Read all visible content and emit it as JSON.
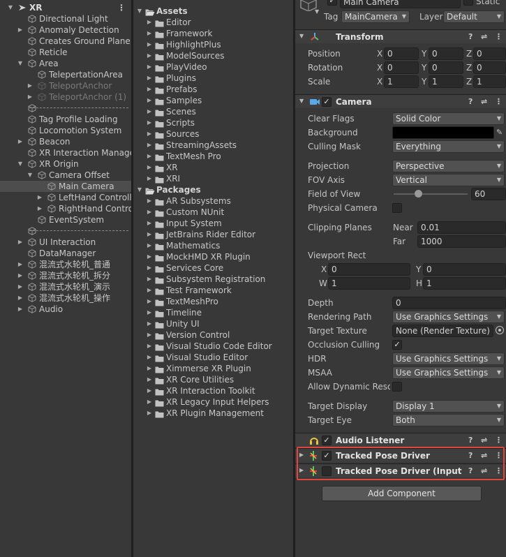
{
  "hierarchy": {
    "menu_glyph": "⋮",
    "rows": [
      {
        "label": "XR",
        "depth": 0,
        "arrow": "down",
        "icon": "unity-scene-icon",
        "scene": true
      },
      {
        "label": "Directional Light",
        "depth": 1,
        "arrow": "none"
      },
      {
        "label": "Anomaly Detection",
        "depth": 1,
        "arrow": "right"
      },
      {
        "label": "Creates Ground Plane",
        "depth": 1,
        "arrow": "none"
      },
      {
        "label": "Reticle",
        "depth": 1,
        "arrow": "none"
      },
      {
        "label": "Area",
        "depth": 1,
        "arrow": "down"
      },
      {
        "label": "TelepertationArea",
        "depth": 2,
        "arrow": "none"
      },
      {
        "label": "TeleportAnchor",
        "depth": 2,
        "arrow": "right",
        "dim": true
      },
      {
        "label": "TeleportAnchor (1)",
        "depth": 2,
        "arrow": "right",
        "dim": true
      },
      {
        "label": "",
        "depth": 1,
        "arrow": "none",
        "separator": true
      },
      {
        "label": "Tag Profile Loading",
        "depth": 1,
        "arrow": "none"
      },
      {
        "label": "Locomotion System",
        "depth": 1,
        "arrow": "none"
      },
      {
        "label": "Beacon",
        "depth": 1,
        "arrow": "right"
      },
      {
        "label": "XR Interaction Manager",
        "depth": 1,
        "arrow": "none"
      },
      {
        "label": "XR Origin",
        "depth": 1,
        "arrow": "down"
      },
      {
        "label": "Camera Offset",
        "depth": 2,
        "arrow": "down"
      },
      {
        "label": "Main Camera",
        "depth": 3,
        "arrow": "none",
        "selected": true
      },
      {
        "label": "LeftHand Controller",
        "depth": 3,
        "arrow": "right"
      },
      {
        "label": "RightHand Controller",
        "depth": 3,
        "arrow": "right"
      },
      {
        "label": "EventSystem",
        "depth": 2,
        "arrow": "none"
      },
      {
        "label": "",
        "depth": 1,
        "arrow": "none",
        "separator": true
      },
      {
        "label": "UI Interaction",
        "depth": 1,
        "arrow": "right"
      },
      {
        "label": "DataManager",
        "depth": 1,
        "arrow": "none"
      },
      {
        "label": "混流式水轮机_普通",
        "depth": 1,
        "arrow": "right"
      },
      {
        "label": "混流式水轮机_拆分",
        "depth": 1,
        "arrow": "right"
      },
      {
        "label": "混流式水轮机_演示",
        "depth": 1,
        "arrow": "right"
      },
      {
        "label": "混流式水轮机_操作",
        "depth": 1,
        "arrow": "right"
      },
      {
        "label": "Audio",
        "depth": 1,
        "arrow": "right"
      }
    ]
  },
  "project": {
    "rows": [
      {
        "label": "Assets",
        "depth": 0,
        "arrow": "down",
        "root": true
      },
      {
        "label": "Editor",
        "depth": 1,
        "arrow": "right"
      },
      {
        "label": "Framework",
        "depth": 1,
        "arrow": "right"
      },
      {
        "label": "HighlightPlus",
        "depth": 1,
        "arrow": "right"
      },
      {
        "label": "ModelSources",
        "depth": 1,
        "arrow": "right"
      },
      {
        "label": "PlayVideo",
        "depth": 1,
        "arrow": "right"
      },
      {
        "label": "Plugins",
        "depth": 1,
        "arrow": "right"
      },
      {
        "label": "Prefabs",
        "depth": 1,
        "arrow": "right"
      },
      {
        "label": "Samples",
        "depth": 1,
        "arrow": "right"
      },
      {
        "label": "Scenes",
        "depth": 1,
        "arrow": "right"
      },
      {
        "label": "Scripts",
        "depth": 1,
        "arrow": "right"
      },
      {
        "label": "Sources",
        "depth": 1,
        "arrow": "right"
      },
      {
        "label": "StreamingAssets",
        "depth": 1,
        "arrow": "right"
      },
      {
        "label": "TextMesh Pro",
        "depth": 1,
        "arrow": "right"
      },
      {
        "label": "XR",
        "depth": 1,
        "arrow": "right"
      },
      {
        "label": "XRI",
        "depth": 1,
        "arrow": "right"
      },
      {
        "label": "Packages",
        "depth": 0,
        "arrow": "down",
        "root": true
      },
      {
        "label": "AR Subsystems",
        "depth": 1,
        "arrow": "right"
      },
      {
        "label": "Custom NUnit",
        "depth": 1,
        "arrow": "right"
      },
      {
        "label": "Input System",
        "depth": 1,
        "arrow": "right"
      },
      {
        "label": "JetBrains Rider Editor",
        "depth": 1,
        "arrow": "right"
      },
      {
        "label": "Mathematics",
        "depth": 1,
        "arrow": "right"
      },
      {
        "label": "MockHMD XR Plugin",
        "depth": 1,
        "arrow": "right"
      },
      {
        "label": "Services Core",
        "depth": 1,
        "arrow": "right"
      },
      {
        "label": "Subsystem Registration",
        "depth": 1,
        "arrow": "right"
      },
      {
        "label": "Test Framework",
        "depth": 1,
        "arrow": "right"
      },
      {
        "label": "TextMeshPro",
        "depth": 1,
        "arrow": "right"
      },
      {
        "label": "Timeline",
        "depth": 1,
        "arrow": "right"
      },
      {
        "label": "Unity UI",
        "depth": 1,
        "arrow": "right"
      },
      {
        "label": "Version Control",
        "depth": 1,
        "arrow": "right"
      },
      {
        "label": "Visual Studio Code Editor",
        "depth": 1,
        "arrow": "right"
      },
      {
        "label": "Visual Studio Editor",
        "depth": 1,
        "arrow": "right"
      },
      {
        "label": "Ximmerse XR Plugin",
        "depth": 1,
        "arrow": "right"
      },
      {
        "label": "XR Core Utilities",
        "depth": 1,
        "arrow": "right"
      },
      {
        "label": "XR Interaction Toolkit",
        "depth": 1,
        "arrow": "right"
      },
      {
        "label": "XR Legacy Input Helpers",
        "depth": 1,
        "arrow": "right"
      },
      {
        "label": "XR Plugin Management",
        "depth": 1,
        "arrow": "right"
      }
    ]
  },
  "inspector": {
    "object_name": "Main Camera",
    "static_label": "Static",
    "tag_label": "Tag",
    "tag_value": "MainCamera",
    "layer_label": "Layer",
    "layer_value": "Default",
    "transform": {
      "title": "Transform",
      "axis_x": "X",
      "axis_y": "Y",
      "axis_z": "Z",
      "position_label": "Position",
      "position": {
        "x": "0",
        "y": "0",
        "z": "0"
      },
      "rotation_label": "Rotation",
      "rotation": {
        "x": "0",
        "y": "0",
        "z": "0"
      },
      "scale_label": "Scale",
      "scale": {
        "x": "1",
        "y": "1",
        "z": "1"
      }
    },
    "camera": {
      "title": "Camera",
      "clear_flags_label": "Clear Flags",
      "clear_flags": "Solid Color",
      "background_label": "Background",
      "background_color": "#000000",
      "culling_mask_label": "Culling Mask",
      "culling_mask": "Everything",
      "projection_label": "Projection",
      "projection": "Perspective",
      "fov_axis_label": "FOV Axis",
      "fov_axis": "Vertical",
      "fov_label": "Field of View",
      "fov_value": "60",
      "fov_slider_fraction": 0.33,
      "physical_camera_label": "Physical Camera",
      "clipping_planes_label": "Clipping Planes",
      "near_label": "Near",
      "near_value": "0.01",
      "far_label": "Far",
      "far_value": "1000",
      "viewport_rect_label": "Viewport Rect",
      "vp_x_label": "X",
      "vp_x": "0",
      "vp_y_label": "Y",
      "vp_y": "0",
      "vp_w_label": "W",
      "vp_w": "1",
      "vp_h_label": "H",
      "vp_h": "1",
      "depth_label": "Depth",
      "depth": "0",
      "rendering_path_label": "Rendering Path",
      "rendering_path": "Use Graphics Settings",
      "target_texture_label": "Target Texture",
      "target_texture": "None (Render Texture)",
      "occlusion_culling_label": "Occlusion Culling",
      "hdr_label": "HDR",
      "hdr": "Use Graphics Settings",
      "msaa_label": "MSAA",
      "msaa": "Use Graphics Settings",
      "allow_dynamic_label": "Allow Dynamic Resol",
      "target_display_label": "Target Display",
      "target_display": "Display 1",
      "target_eye_label": "Target Eye",
      "target_eye": "Both"
    },
    "audio_listener_title": "Audio Listener",
    "tracked_pose_title": "Tracked Pose Driver",
    "tracked_pose_input_title": "Tracked Pose Driver (Input Sys",
    "add_component_label": "Add Component",
    "help_glyph": "?",
    "preset_glyph": "⇌",
    "menu_glyph": "⋮",
    "check_glyph": "✓",
    "colors": {
      "highlight": "#e0463a",
      "accent_blue": "#5aa9e6"
    }
  }
}
